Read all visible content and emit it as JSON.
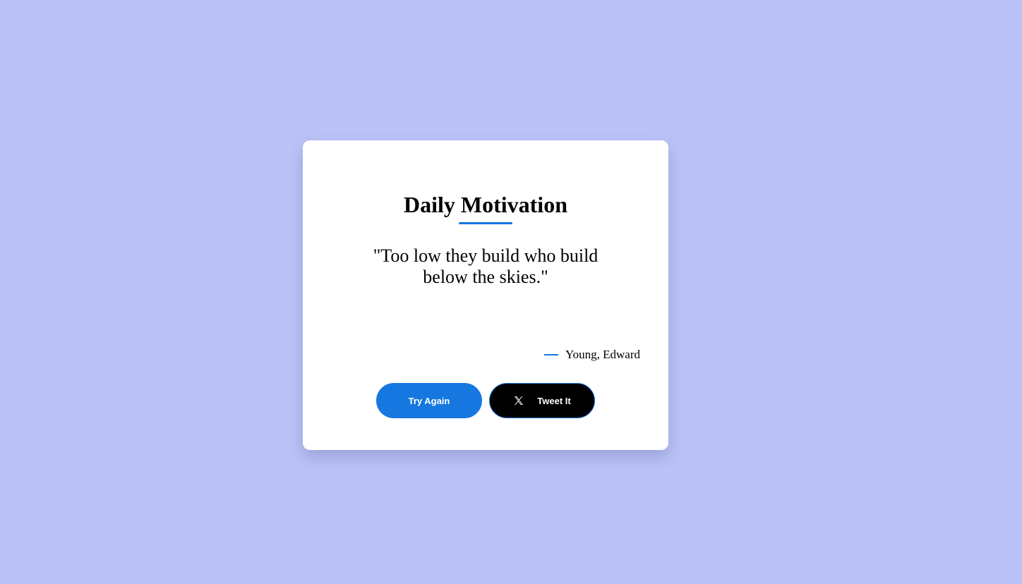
{
  "card": {
    "title": "Daily Motivation",
    "quote": "\"Too low they build who build below the skies.\"",
    "author": "Young, Edward"
  },
  "buttons": {
    "try_again_label": "Try Again",
    "tweet_label": "Tweet It",
    "tweet_icon": "x-logo-icon"
  },
  "colors": {
    "background": "#bbc3f6",
    "accent": "#1677e0",
    "tweet_button": "#000000"
  }
}
